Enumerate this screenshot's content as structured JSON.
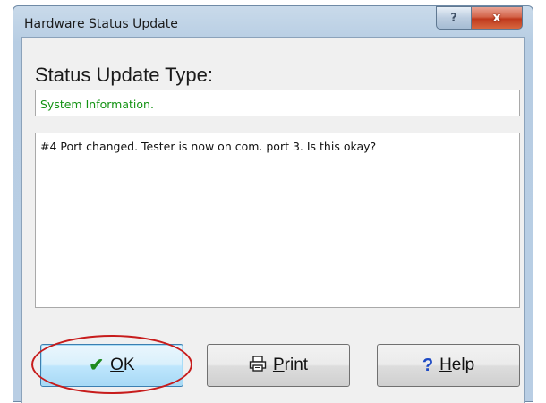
{
  "window": {
    "title": "Hardware Status Update",
    "caption_help_glyph": "?",
    "caption_close_glyph": "x"
  },
  "status": {
    "heading": "Status Update Type:",
    "type_value": "System Information.",
    "message": "#4 Port changed.  Tester is now on com. port 3.  Is this okay?"
  },
  "buttons": {
    "ok": {
      "icon": "checkmark-icon",
      "mnemonic": "O",
      "rest": "K"
    },
    "print": {
      "icon": "printer-icon",
      "mnemonic": "P",
      "rest": "rint"
    },
    "help": {
      "icon": "question-icon",
      "mnemonic": "H",
      "rest": "elp"
    }
  },
  "colors": {
    "type_text": "#129212",
    "highlight_ring": "#c71c1c",
    "close_button": "#c0391d"
  }
}
